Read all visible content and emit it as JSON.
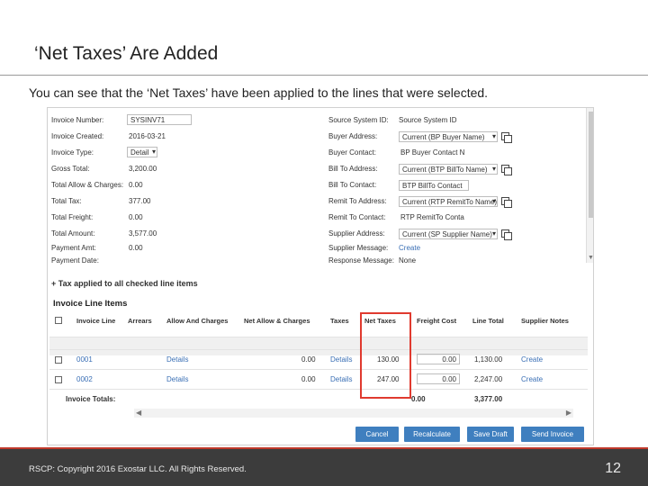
{
  "slide": {
    "title": "‘Net Taxes’ Are Added",
    "subtitle": "You can see that the ‘Net Taxes’ have been applied to the lines that were selected.",
    "footer": "RSCP: Copyright 2016 Exostar LLC. All Rights Reserved.",
    "page_number": "12"
  },
  "header_left": [
    {
      "label": "Invoice Number:",
      "value": "SYSINV71"
    },
    {
      "label": "Invoice Created:",
      "value": "2016-03-21"
    },
    {
      "label": "Invoice Type:",
      "value": "Detail"
    },
    {
      "label": "Gross Total:",
      "value": "3,200.00"
    },
    {
      "label": "Total Allow & Charges:",
      "value": "0.00"
    },
    {
      "label": "Total Tax:",
      "value": "377.00"
    },
    {
      "label": "Total Freight:",
      "value": "0.00"
    },
    {
      "label": "Total Amount:",
      "value": "3,577.00"
    },
    {
      "label": "Payment Amt:",
      "value": "0.00"
    },
    {
      "label": "Payment Date:",
      "value": ""
    }
  ],
  "header_right": [
    {
      "label": "Source System ID:",
      "value": "Source System ID"
    },
    {
      "label": "Buyer Address:",
      "value": "Current (BP Buyer Name)"
    },
    {
      "label": "Buyer Contact:",
      "value": "BP Buyer Contact N"
    },
    {
      "label": "Bill To Address:",
      "value": "Current (BTP BillTo Name)"
    },
    {
      "label": "Bill To Contact:",
      "value": "BTP BillTo Contact"
    },
    {
      "label": "Remit To Address:",
      "value": "Current (RTP RemitTo Name)"
    },
    {
      "label": "Remit To Contact:",
      "value": "RTP RemitTo Conta"
    },
    {
      "label": "Supplier Address:",
      "value": "Current (SP Supplier Name)"
    },
    {
      "label": "Supplier Message:",
      "value": "Create"
    },
    {
      "label": "Response Message:",
      "value": "None"
    }
  ],
  "tax_message": "Tax applied to all checked line items",
  "lines_title": "Invoice Line Items",
  "columns": [
    "Invoice Line",
    "Arrears",
    "Allow And Charges",
    "Net Allow & Charges",
    "Taxes",
    "Net Taxes",
    "Freight Cost",
    "Line Total",
    "Supplier Notes"
  ],
  "rows": [
    {
      "line": "0001",
      "details": "Details",
      "net_allow": "0.00",
      "taxes": "Details",
      "net_taxes": "130.00",
      "freight": "0.00",
      "line_total": "1,130.00",
      "notes": "Create"
    },
    {
      "line": "0002",
      "details": "Details",
      "net_allow": "0.00",
      "taxes": "Details",
      "net_taxes": "247.00",
      "freight": "0.00",
      "line_total": "2,247.00",
      "notes": "Create"
    }
  ],
  "totals": {
    "label": "Invoice Totals:",
    "freight": "0.00",
    "line_total": "3,377.00"
  },
  "buttons": {
    "cancel": "Cancel",
    "recalculate": "Recalculate",
    "save_draft": "Save Draft",
    "send_invoice": "Send Invoice"
  },
  "colors": {
    "accent_red": "#e03a2f",
    "button_blue": "#3f7fbf",
    "link_blue": "#3a6fb5"
  }
}
